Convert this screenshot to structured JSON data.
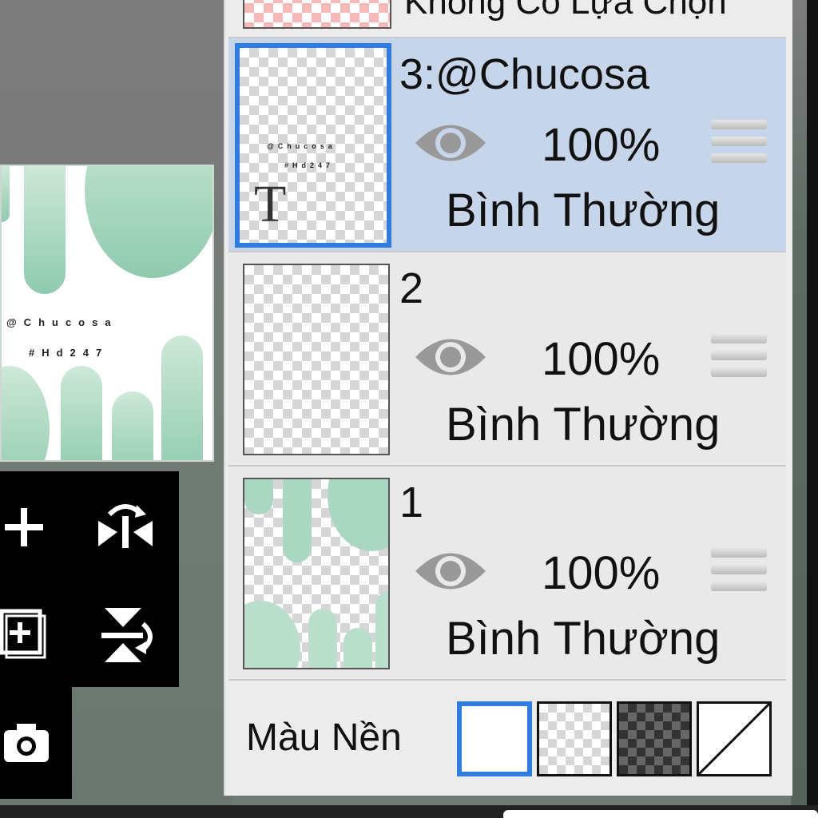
{
  "layers_panel": {
    "top_row_label": "Không Có Lựa Chọn",
    "layers": [
      {
        "name": "3:@Chucosa",
        "opacity": "100%",
        "blend_mode": "Bình Thường",
        "selected": true,
        "type_icon": "T"
      },
      {
        "name": "2",
        "opacity": "100%",
        "blend_mode": "Bình Thường",
        "selected": false
      },
      {
        "name": "1",
        "opacity": "100%",
        "blend_mode": "Bình Thường",
        "selected": false
      }
    ],
    "background": {
      "label": "Màu Nền",
      "swatches": [
        "white",
        "checker-light",
        "checker-dark",
        "none"
      ],
      "selected_swatch": "white"
    }
  },
  "canvas": {
    "watermark_line1": "@Chucosa",
    "watermark_line2": "#Hd247"
  },
  "tools": [
    "add-layer-icon",
    "flip-horizontal-icon",
    "add-layer-copy-icon",
    "flip-vertical-icon",
    "camera-icon"
  ],
  "colors": {
    "accent": "#2f7de0",
    "selected_row": "#c6d5ea",
    "eye": "#999999"
  }
}
